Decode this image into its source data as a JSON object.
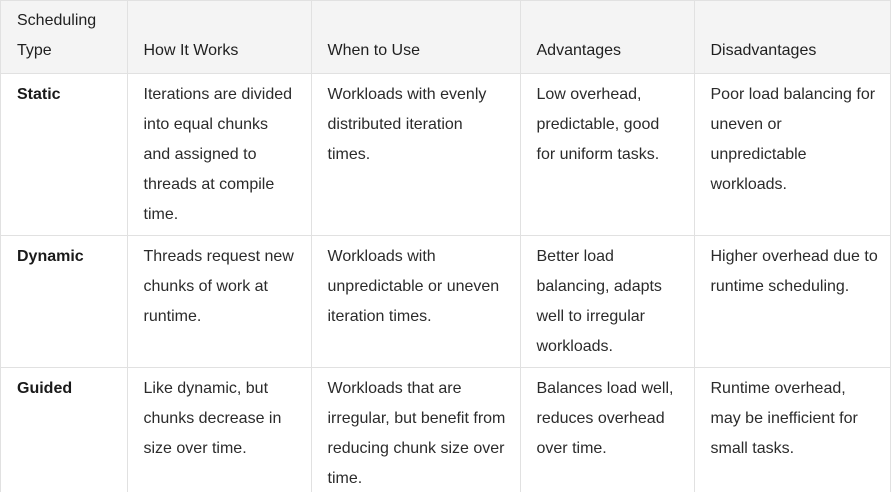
{
  "table": {
    "headers": [
      "Scheduling Type",
      "How It Works",
      "When to Use",
      "Advantages",
      "Disadvantages"
    ],
    "rows": [
      {
        "type": "Static",
        "how": "Iterations are divided into equal chunks and assigned to threads at compile time.",
        "when": "Workloads with evenly distributed iteration times.",
        "advantages": "Low overhead, predictable, good for uniform tasks.",
        "disadvantages": "Poor load balancing for uneven or unpredictable workloads."
      },
      {
        "type": "Dynamic",
        "how": "Threads request new chunks of work at runtime.",
        "when": "Workloads with unpredictable or uneven iteration times.",
        "advantages": "Better load balancing, adapts well to irregular workloads.",
        "disadvantages": "Higher overhead due to runtime scheduling."
      },
      {
        "type": "Guided",
        "how": "Like dynamic, but chunks decrease in size over time.",
        "when": "Workloads that are irregular, but benefit from reducing chunk size over time.",
        "advantages": "Balances load well, reduces overhead over time.",
        "disadvantages": "Runtime overhead, may be inefficient for small tasks."
      }
    ]
  }
}
